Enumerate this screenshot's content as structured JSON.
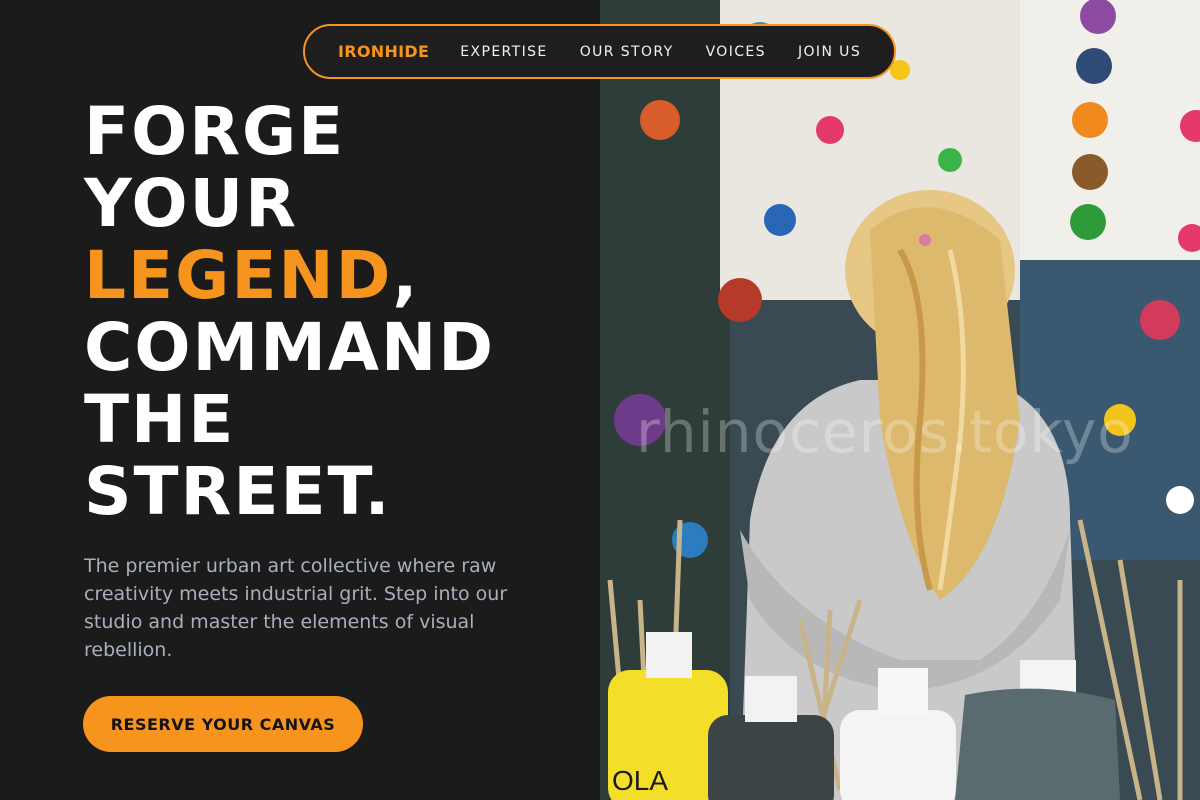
{
  "nav": {
    "brand": "IRONHIDE",
    "links": [
      "EXPERTISE",
      "OUR STORY",
      "VOICES",
      "JOIN US"
    ]
  },
  "hero": {
    "line1": "FORGE",
    "line2": "YOUR",
    "line3_accent": "LEGEND",
    "line3_rest": ",",
    "line4": "COMMAND",
    "line5": "THE",
    "line6": "STREET.",
    "subtext": "The premier urban art collective where raw creativity meets industrial grit. Step into our studio and master the elements of visual rebellion.",
    "cta_label": "RESERVE YOUR CANVAS"
  },
  "photo": {
    "watermark": "rhinoceros.tokyo",
    "bottle_labels": [
      "OLA"
    ]
  },
  "colors": {
    "accent": "#f7941d",
    "background": "#1b1b1c",
    "heading": "#ffffff",
    "body_text": "#a7b0bc"
  }
}
